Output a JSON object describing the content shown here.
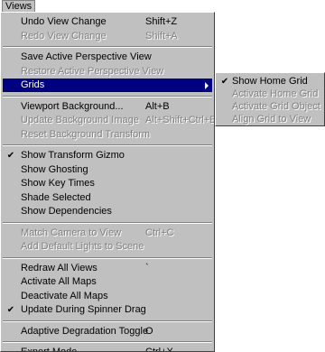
{
  "menubar": {
    "title": "Views"
  },
  "menu": {
    "groups": [
      [
        {
          "label": "Undo View Change",
          "shortcut": "Shift+Z",
          "disabled": false
        },
        {
          "label": "Redo View Change",
          "shortcut": "Shift+A",
          "disabled": true
        }
      ],
      [
        {
          "label": "Save Active Perspective View",
          "disabled": false
        },
        {
          "label": "Restore Active Perspective View",
          "disabled": true
        },
        {
          "label": "Grids",
          "submenu": true,
          "highlighted": true
        }
      ],
      [
        {
          "label": "Viewport Background...",
          "shortcut": "Alt+B",
          "disabled": false
        },
        {
          "label": "Update Background Image",
          "shortcut": "Alt+Shift+Ctrl+B",
          "disabled": true
        },
        {
          "label": "Reset Background Transform",
          "disabled": true
        }
      ],
      [
        {
          "label": "Show Transform Gizmo",
          "checked": true,
          "disabled": false
        },
        {
          "label": "Show Ghosting",
          "disabled": false
        },
        {
          "label": "Show Key Times",
          "disabled": false
        },
        {
          "label": "Shade Selected",
          "disabled": false
        },
        {
          "label": "Show Dependencies",
          "disabled": false
        }
      ],
      [
        {
          "label": "Match Camera to View",
          "shortcut": "Ctrl+C",
          "disabled": true
        },
        {
          "label": "Add Default Lights to Scene",
          "disabled": true
        }
      ],
      [
        {
          "label": "Redraw All Views",
          "shortcut": "`",
          "disabled": false
        },
        {
          "label": "Activate All Maps",
          "disabled": false
        },
        {
          "label": "Deactivate All Maps",
          "disabled": false
        },
        {
          "label": "Update During Spinner Drag",
          "checked": true,
          "disabled": false
        }
      ],
      [
        {
          "label": "Adaptive Degradation Toggle",
          "shortcut": "O",
          "disabled": false
        }
      ],
      [
        {
          "label": "Expert Mode",
          "shortcut": "Ctrl+X",
          "disabled": false
        }
      ]
    ]
  },
  "submenu": {
    "items": [
      {
        "label": "Show Home Grid",
        "checked": true,
        "disabled": false
      },
      {
        "label": "Activate Home Grid",
        "disabled": true
      },
      {
        "label": "Activate Grid Object",
        "disabled": true
      },
      {
        "label": "Align Grid to View",
        "disabled": true
      }
    ]
  }
}
